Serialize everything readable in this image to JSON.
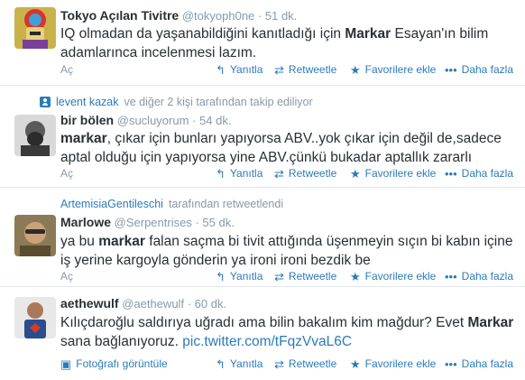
{
  "colors": {
    "link": "#2b7bb9",
    "muted": "#8899a6",
    "text": "#292f33",
    "divider": "#e1e8ed"
  },
  "actions": {
    "reply": "Yanıtla",
    "retweet": "Retweetle",
    "favorite": "Favorilere ekle",
    "more": "Daha fazla",
    "open": "Aç",
    "view_photo": "Fotoğrafı görüntüle"
  },
  "tweets": [
    {
      "name": "Tokyo Açılan Tivitre",
      "handle": "@tokyoph0ne",
      "time": "51 dk.",
      "text_parts": [
        "IQ olmadan da yaşanabildiğini kanıtladığı için ",
        "Markar",
        " Esayan'ın bilim adamlarınca incelenmesi lazım."
      ]
    },
    {
      "context_user": "levent kazak",
      "context_rest": "ve diğer 2 kişi tarafından takip ediliyor",
      "name": "bir bölen",
      "handle": "@sucluyorum",
      "time": "54 dk.",
      "text_parts": [
        "markar",
        ", çıkar için bunları yapıyorsa ABV..yok çıkar için değil de,sadece aptal olduğu için yapıyorsa yine ABV.çünkü bukadar aptallık zararlı"
      ]
    },
    {
      "context_user": "ArtemisiaGentileschi",
      "context_rest": "tarafından retweetlendi",
      "name": "Marlowe",
      "handle": "@Serpentrises",
      "time": "55 dk.",
      "text_parts": [
        "ya bu ",
        "markar",
        " falan saçma bi tivit attığında üşenmeyin sıçın bi kabın içine iş yerine kargoyla gönderin ya ironi ironi bezdik be"
      ]
    },
    {
      "name": "aethewulf",
      "handle": "@aethewulf",
      "time": "60 dk.",
      "text_parts": [
        "Kılıçdaroğlu saldırıya uğradı ama bilin bakalım kim mağdur? Evet ",
        "Markar",
        " sana bağlanıyoruz. "
      ],
      "link": "pic.twitter.com/tFqzVvaL6C"
    }
  ]
}
